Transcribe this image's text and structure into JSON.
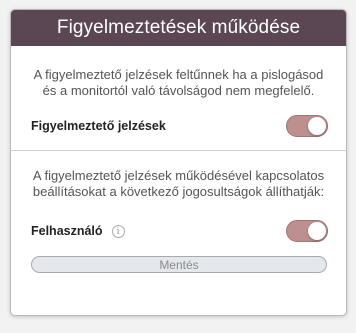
{
  "panel": {
    "title": "Figyelmeztetések működése",
    "alerts_section": {
      "description": "A figyelmeztető jelzések feltűnnek ha a pislogásod és a monitortól való távolságod nem megfelelő.",
      "toggle_label": "Figyelmeztető jelzések",
      "toggle_on": true
    },
    "permissions_section": {
      "description": "A figyelmeztető jelzések működésével kapcsolatos beállításokat a következő jogosultságok állíthatják:",
      "user_label": "Felhasználó",
      "info_glyph": "i",
      "info_icon": "info-icon",
      "toggle_on": true
    },
    "save_label": "Mentés"
  },
  "colors": {
    "header_bg": "#5b4753",
    "toggle_on": "#bd8f8f",
    "button_bg": "#e4e8ec"
  }
}
